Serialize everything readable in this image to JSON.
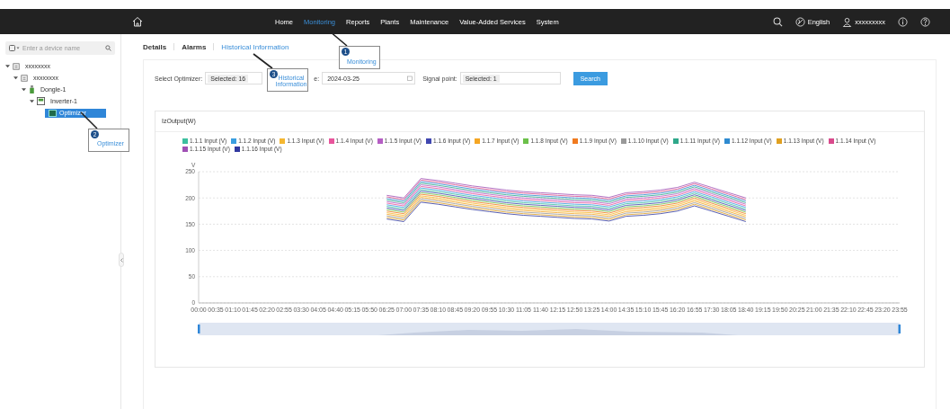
{
  "nav": {
    "items": [
      {
        "label": "Home",
        "selected": false
      },
      {
        "label": "Monitoring",
        "selected": true
      },
      {
        "label": "Reports",
        "selected": false
      },
      {
        "label": "Plants",
        "selected": false
      },
      {
        "label": "Maintenance",
        "selected": false
      },
      {
        "label": "Value-Added Services",
        "selected": false
      },
      {
        "label": "System",
        "selected": false
      }
    ],
    "language": "English",
    "user": "xxxxxxxxx"
  },
  "sidebar": {
    "search": {
      "placeholder": "Enter a device name"
    },
    "tree": [
      {
        "label": "xxxxxxxx",
        "kind": "plant",
        "expanded": true,
        "selected": false,
        "children": [
          {
            "label": "xxxxxxxx",
            "kind": "plant",
            "expanded": true,
            "selected": false,
            "children": [
              {
                "label": "Dongle-1",
                "kind": "dongle",
                "expanded": true,
                "selected": false,
                "children": [
                  {
                    "label": "Inverter-1",
                    "kind": "inverter",
                    "expanded": true,
                    "selected": false,
                    "children": [
                      {
                        "label": "Optimizer",
                        "kind": "optimizer",
                        "selected": true
                      }
                    ]
                  }
                ]
              }
            ]
          }
        ]
      }
    ]
  },
  "tabs": [
    {
      "label": "Details",
      "selected": false
    },
    {
      "label": "Alarms",
      "selected": false
    },
    {
      "label": "Historical Information",
      "selected": true
    }
  ],
  "filters": {
    "optimizer_label": "Select Optimizer:",
    "optimizer_value": "Selected: 16",
    "date_label": "e:",
    "date_value": "2024-03-25",
    "signal_label": "Signal point:",
    "signal_value": "Selected: 1",
    "search_button": "Search"
  },
  "chart_panel": {
    "title": "IzOutput(W)",
    "chart_data": {
      "type": "line",
      "grid": true,
      "ylabel": "V",
      "yticks": [
        0,
        50,
        100,
        150,
        200,
        250
      ],
      "ylim": [
        0,
        250
      ],
      "x": [
        "00:00",
        "00:35",
        "01:10",
        "01:45",
        "02:20",
        "02:55",
        "03:30",
        "04:05",
        "04:40",
        "05:15",
        "05:50",
        "06:25",
        "07:00",
        "07:35",
        "08:10",
        "08:45",
        "09:20",
        "09:55",
        "10:30",
        "11:05",
        "11:40",
        "12:15",
        "12:50",
        "13:25",
        "14:00",
        "14:35",
        "15:10",
        "15:45",
        "16:20",
        "16:55",
        "17:30",
        "18:05",
        "18:40",
        "19:15",
        "19:50",
        "20:25",
        "21:00",
        "21:35",
        "22:10",
        "22:45",
        "23:20",
        "23:55"
      ],
      "series": [
        {
          "name": "1.1.1 Input (V)",
          "color": "#3dbf9f",
          "values": [
            null,
            null,
            null,
            null,
            null,
            null,
            null,
            null,
            null,
            null,
            null,
            184,
            179,
            216,
            212,
            207,
            202,
            198,
            194,
            191,
            189,
            187,
            185,
            184,
            180,
            189,
            191,
            194,
            199,
            209,
            199,
            189,
            179,
            null,
            null,
            null,
            null,
            null,
            null,
            null,
            null,
            null
          ]
        },
        {
          "name": "1.1.2 Input (V)",
          "color": "#3a9ee0",
          "values": [
            null,
            null,
            null,
            null,
            null,
            null,
            null,
            null,
            null,
            null,
            null,
            187,
            182,
            219,
            215,
            210,
            205,
            201,
            197,
            194,
            192,
            190,
            188,
            187,
            183,
            192,
            194,
            197,
            202,
            212,
            202,
            192,
            182,
            null,
            null,
            null,
            null,
            null,
            null,
            null,
            null,
            null
          ]
        },
        {
          "name": "1.1.3 Input (V)",
          "color": "#f5b731",
          "values": [
            null,
            null,
            null,
            null,
            null,
            null,
            null,
            null,
            null,
            null,
            null,
            172,
            167,
            204,
            200,
            195,
            190,
            186,
            182,
            179,
            177,
            175,
            173,
            172,
            168,
            177,
            179,
            182,
            187,
            197,
            187,
            177,
            167,
            null,
            null,
            null,
            null,
            null,
            null,
            null,
            null,
            null
          ]
        },
        {
          "name": "1.1.4 Input (V)",
          "color": "#e8559c",
          "values": [
            null,
            null,
            null,
            null,
            null,
            null,
            null,
            null,
            null,
            null,
            null,
            190,
            185,
            222,
            218,
            213,
            208,
            204,
            200,
            197,
            195,
            193,
            191,
            190,
            186,
            195,
            197,
            200,
            205,
            215,
            205,
            195,
            185,
            null,
            null,
            null,
            null,
            null,
            null,
            null,
            null,
            null
          ]
        },
        {
          "name": "1.1.5 Input (V)",
          "color": "#b55ec4",
          "values": [
            null,
            null,
            null,
            null,
            null,
            null,
            null,
            null,
            null,
            null,
            null,
            193,
            188,
            225,
            221,
            216,
            211,
            207,
            203,
            200,
            198,
            196,
            194,
            193,
            189,
            198,
            200,
            203,
            208,
            218,
            208,
            198,
            188,
            null,
            null,
            null,
            null,
            null,
            null,
            null,
            null,
            null
          ]
        },
        {
          "name": "1.1.6 Input (V)",
          "color": "#4047b0",
          "values": [
            null,
            null,
            null,
            null,
            null,
            null,
            null,
            null,
            null,
            null,
            null,
            181,
            176,
            213,
            209,
            204,
            199,
            195,
            191,
            188,
            186,
            184,
            182,
            181,
            177,
            186,
            188,
            191,
            196,
            206,
            196,
            186,
            176,
            null,
            null,
            null,
            null,
            null,
            null,
            null,
            null,
            null
          ]
        },
        {
          "name": "1.1.7 Input (V)",
          "color": "#f5a623",
          "values": [
            null,
            null,
            null,
            null,
            null,
            null,
            null,
            null,
            null,
            null,
            null,
            169,
            164,
            201,
            197,
            192,
            187,
            183,
            179,
            176,
            174,
            172,
            170,
            169,
            165,
            174,
            176,
            179,
            184,
            194,
            184,
            174,
            164,
            null,
            null,
            null,
            null,
            null,
            null,
            null,
            null,
            null
          ]
        },
        {
          "name": "1.1.8 Input (V)",
          "color": "#6cc04a",
          "values": [
            null,
            null,
            null,
            null,
            null,
            null,
            null,
            null,
            null,
            null,
            null,
            178,
            173,
            210,
            206,
            201,
            196,
            192,
            188,
            185,
            183,
            181,
            179,
            178,
            174,
            183,
            185,
            188,
            193,
            203,
            193,
            183,
            173,
            null,
            null,
            null,
            null,
            null,
            null,
            null,
            null,
            null
          ]
        },
        {
          "name": "1.1.9 Input (V)",
          "color": "#f07a1f",
          "values": [
            null,
            null,
            null,
            null,
            null,
            null,
            null,
            null,
            null,
            null,
            null,
            175,
            170,
            207,
            203,
            198,
            193,
            189,
            185,
            182,
            180,
            178,
            176,
            175,
            171,
            180,
            182,
            185,
            190,
            200,
            190,
            180,
            170,
            null,
            null,
            null,
            null,
            null,
            null,
            null,
            null,
            null
          ]
        },
        {
          "name": "1.1.10 Input (V)",
          "color": "#999999",
          "values": [
            null,
            null,
            null,
            null,
            null,
            null,
            null,
            null,
            null,
            null,
            null,
            166,
            161,
            198,
            194,
            189,
            184,
            180,
            176,
            173,
            171,
            169,
            167,
            166,
            162,
            171,
            173,
            176,
            181,
            191,
            181,
            171,
            161,
            null,
            null,
            null,
            null,
            null,
            null,
            null,
            null,
            null
          ]
        },
        {
          "name": "1.1.11 Input (V)",
          "color": "#2fa88a",
          "values": [
            null,
            null,
            null,
            null,
            null,
            null,
            null,
            null,
            null,
            null,
            null,
            196,
            191,
            228,
            224,
            219,
            214,
            210,
            206,
            203,
            201,
            199,
            197,
            196,
            192,
            201,
            203,
            206,
            211,
            221,
            211,
            201,
            191,
            null,
            null,
            null,
            null,
            null,
            null,
            null,
            null,
            null
          ]
        },
        {
          "name": "1.1.12 Input (V)",
          "color": "#2e8ad0",
          "values": [
            null,
            null,
            null,
            null,
            null,
            null,
            null,
            null,
            null,
            null,
            null,
            199,
            194,
            231,
            227,
            222,
            217,
            213,
            209,
            206,
            204,
            202,
            200,
            199,
            195,
            204,
            206,
            209,
            214,
            224,
            214,
            204,
            194,
            null,
            null,
            null,
            null,
            null,
            null,
            null,
            null,
            null
          ]
        },
        {
          "name": "1.1.13 Input (V)",
          "color": "#e0a020",
          "values": [
            null,
            null,
            null,
            null,
            null,
            null,
            null,
            null,
            null,
            null,
            null,
            163,
            158,
            195,
            191,
            186,
            181,
            177,
            173,
            170,
            168,
            166,
            164,
            163,
            159,
            168,
            170,
            173,
            178,
            188,
            178,
            168,
            158,
            null,
            null,
            null,
            null,
            null,
            null,
            null,
            null,
            null
          ]
        },
        {
          "name": "1.1.14 Input (V)",
          "color": "#d94a8c",
          "values": [
            null,
            null,
            null,
            null,
            null,
            null,
            null,
            null,
            null,
            null,
            null,
            202,
            197,
            234,
            230,
            225,
            220,
            216,
            212,
            209,
            207,
            205,
            203,
            202,
            198,
            207,
            209,
            212,
            217,
            227,
            217,
            207,
            197,
            null,
            null,
            null,
            null,
            null,
            null,
            null,
            null,
            null
          ]
        },
        {
          "name": "1.1.15 Input (V)",
          "color": "#a050b5",
          "values": [
            null,
            null,
            null,
            null,
            null,
            null,
            null,
            null,
            null,
            null,
            null,
            205,
            200,
            237,
            233,
            228,
            223,
            219,
            215,
            212,
            210,
            208,
            206,
            205,
            201,
            210,
            212,
            215,
            220,
            230,
            220,
            210,
            200,
            null,
            null,
            null,
            null,
            null,
            null,
            null,
            null,
            null
          ]
        },
        {
          "name": "1.1.16 Input (V)",
          "color": "#3038a0",
          "values": [
            null,
            null,
            null,
            null,
            null,
            null,
            null,
            null,
            null,
            null,
            null,
            160,
            155,
            192,
            188,
            183,
            178,
            174,
            170,
            167,
            165,
            163,
            161,
            160,
            156,
            165,
            167,
            170,
            175,
            185,
            175,
            165,
            155,
            null,
            null,
            null,
            null,
            null,
            null,
            null,
            null,
            null
          ]
        }
      ]
    }
  },
  "callouts": [
    {
      "number": "1",
      "label": "Monitoring"
    },
    {
      "number": "2",
      "label": "Optimizer"
    },
    {
      "number": "3",
      "label": "Historical Information"
    }
  ]
}
